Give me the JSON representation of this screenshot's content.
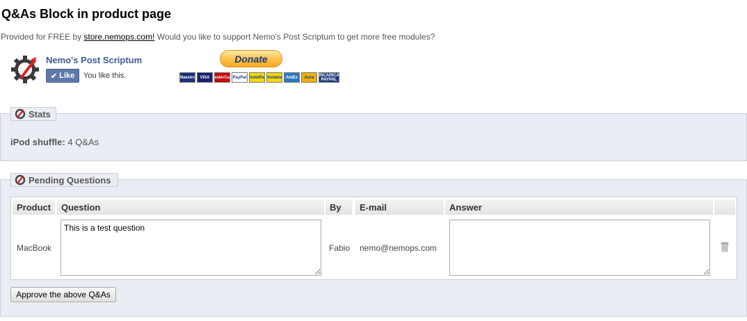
{
  "page": {
    "title": "Q&As Block in product page"
  },
  "provided": {
    "prefix": "Provided for FREE by",
    "link": "store.nemops.com!",
    "suffix": "Would you like to support Nemo's Post Scriptum to get more free modules?"
  },
  "brand": {
    "name": "Nemo's Post Scriptum",
    "like_label": "Like",
    "like_text": "You like this."
  },
  "donate": {
    "label": "Donate",
    "cards": [
      {
        "label": "Maestro",
        "color": "#1c2f7a"
      },
      {
        "label": "VISA",
        "color": "#1a1f71"
      },
      {
        "label": "MasterCard",
        "color": "#cc0000"
      },
      {
        "label": "PayPal",
        "color": "#ffffff"
      },
      {
        "label": "PostePay",
        "color": "#f5d800"
      },
      {
        "label": "Postamat",
        "color": "#f5d800"
      },
      {
        "label": "AmEx",
        "color": "#2e77bb"
      },
      {
        "label": "Aura",
        "color": "#f0b000"
      },
      {
        "label": "RICARICA PAYPAL",
        "color": "#1c3c7a"
      }
    ]
  },
  "stats": {
    "legend": "Stats",
    "product": "iPod shuffle:",
    "count": "4 Q&As"
  },
  "pending": {
    "legend": "Pending Questions",
    "columns": [
      "Product",
      "Question",
      "By",
      "E-mail",
      "Answer"
    ],
    "rows": [
      {
        "product": "MacBook",
        "question": "This is a test question",
        "by": "Fabio",
        "email": "nemo@nemops.com",
        "answer": ""
      }
    ],
    "approve_label": "Approve the above Q&As"
  }
}
